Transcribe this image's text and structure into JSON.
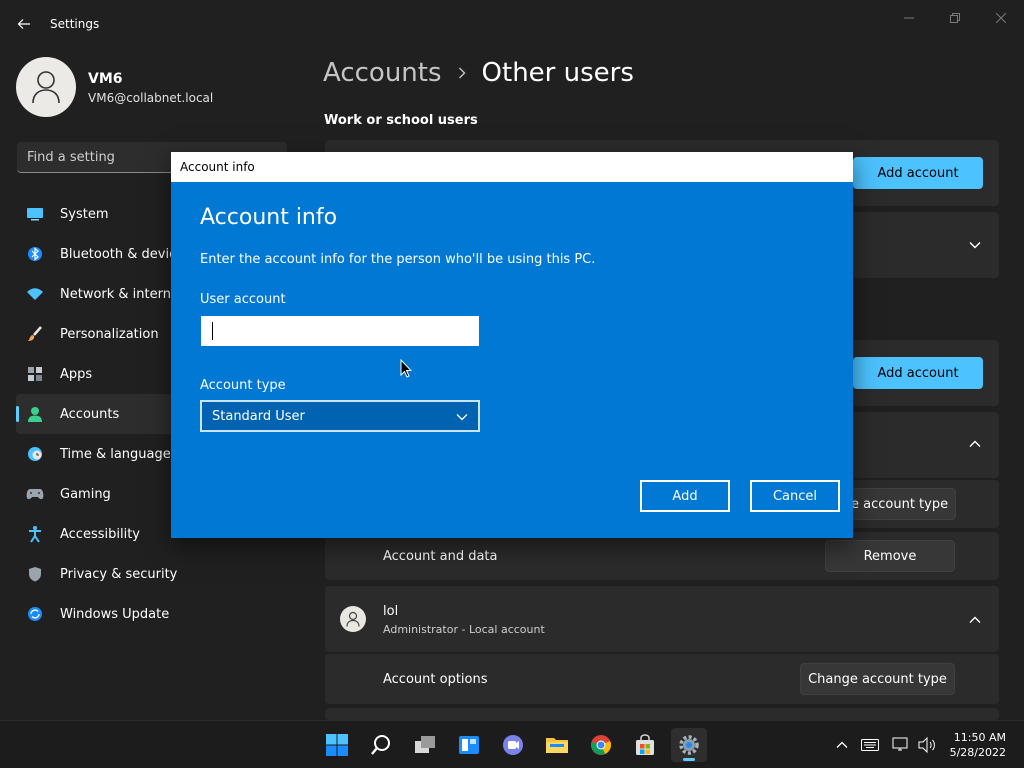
{
  "window": {
    "title": "Settings"
  },
  "profile": {
    "name": "VM6",
    "email": "VM6@collabnet.local"
  },
  "search": {
    "placeholder": "Find a setting"
  },
  "nav": {
    "items": [
      {
        "label": "System",
        "icon": "monitor-icon"
      },
      {
        "label": "Bluetooth & devic",
        "icon": "bluetooth-icon"
      },
      {
        "label": "Network & interne",
        "icon": "wifi-icon"
      },
      {
        "label": "Personalization",
        "icon": "brush-icon"
      },
      {
        "label": "Apps",
        "icon": "apps-icon"
      },
      {
        "label": "Accounts",
        "icon": "person-icon",
        "active": true
      },
      {
        "label": "Time & language",
        "icon": "clock-globe-icon"
      },
      {
        "label": "Gaming",
        "icon": "gamepad-icon"
      },
      {
        "label": "Accessibility",
        "icon": "accessibility-icon"
      },
      {
        "label": "Privacy & security",
        "icon": "shield-icon"
      },
      {
        "label": "Windows Update",
        "icon": "update-icon"
      }
    ]
  },
  "main": {
    "breadcrumb": {
      "parent": "Accounts",
      "current": "Other users"
    },
    "section_title": "Work or school users",
    "add_account_label": "Add account",
    "add_account_label_2": "Add account",
    "change_account_type_partial": "e account type",
    "account_and_data_label": "Account and data",
    "remove_label": "Remove",
    "user": {
      "name": "lol",
      "subtitle": "Administrator - Local account"
    },
    "account_options_label": "Account options",
    "change_account_type_label": "Change account type"
  },
  "dialog": {
    "window_title": "Account info",
    "heading": "Account info",
    "description": "Enter the account info for the person who'll be using this PC.",
    "user_account_label": "User account",
    "user_account_value": "",
    "account_type_label": "Account type",
    "account_type_value": "Standard User",
    "add_label": "Add",
    "cancel_label": "Cancel"
  },
  "taskbar": {
    "time": "11:50 AM",
    "date": "5/28/2022"
  },
  "colors": {
    "accent": "#4cc2ff",
    "dialog_bg": "#0078d4",
    "background": "#202020",
    "card": "#2b2b2b"
  }
}
